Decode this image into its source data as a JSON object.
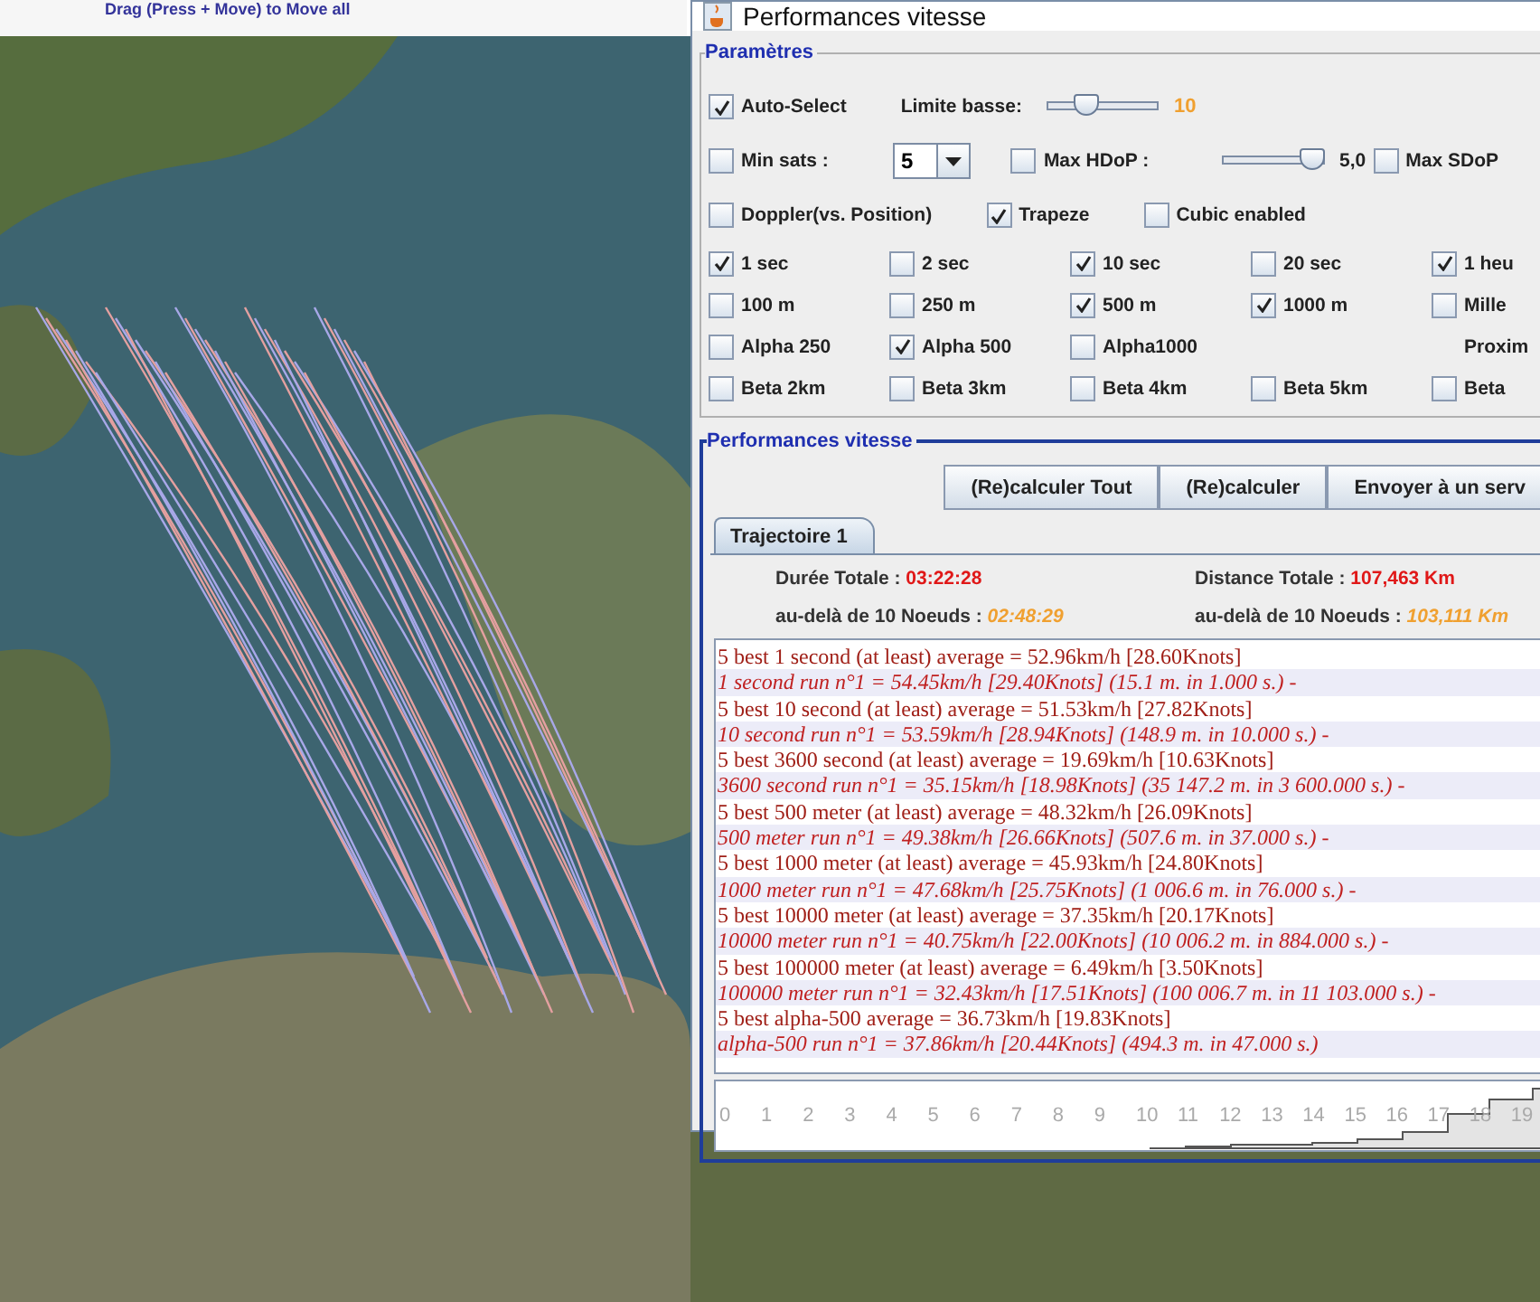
{
  "hint": "Drag (Press + Move) to Move all",
  "window": {
    "title": "Performances vitesse"
  },
  "parameters": {
    "title": "Paramètres",
    "rows": [
      {
        "kind": "controls",
        "items": [
          {
            "kind": "checkbox",
            "label": "Auto-Select",
            "checked": true
          },
          {
            "kind": "label",
            "text": "Limite basse:"
          },
          {
            "kind": "slider",
            "level": 0.3
          },
          {
            "kind": "value",
            "text": "10"
          }
        ]
      },
      {
        "kind": "controls",
        "items": [
          {
            "kind": "checkbox",
            "label": "Min sats :",
            "checked": false
          },
          {
            "kind": "combo",
            "value": "5"
          },
          {
            "kind": "checkbox",
            "label": "Max HDoP :",
            "checked": false
          },
          {
            "kind": "slider",
            "level": 1
          },
          {
            "kind": "label",
            "text": "5,0"
          },
          {
            "kind": "checkbox",
            "label": "Max SDoP",
            "checked": false
          }
        ]
      },
      {
        "kind": "controls",
        "items": [
          {
            "kind": "checkbox",
            "label": "Doppler(vs. Position)",
            "checked": false
          },
          {
            "kind": "checkbox",
            "label": "Trapeze",
            "checked": true
          },
          {
            "kind": "checkbox",
            "label": "Cubic enabled",
            "checked": false
          }
        ]
      },
      {
        "kind": "options",
        "items": [
          {
            "kind": "checkbox",
            "label": "1 sec",
            "checked": true
          },
          {
            "kind": "checkbox",
            "label": "2 sec",
            "checked": false
          },
          {
            "kind": "checkbox",
            "label": "10 sec",
            "checked": true
          },
          {
            "kind": "checkbox",
            "label": "20 sec",
            "checked": false
          },
          {
            "kind": "checkbox",
            "label": "1 heu",
            "checked": true
          }
        ]
      },
      {
        "kind": "options",
        "items": [
          {
            "kind": "checkbox",
            "label": "100 m",
            "checked": false
          },
          {
            "kind": "checkbox",
            "label": "250 m",
            "checked": false
          },
          {
            "kind": "checkbox",
            "label": "500 m",
            "checked": true
          },
          {
            "kind": "checkbox",
            "label": "1000 m",
            "checked": true
          },
          {
            "kind": "checkbox",
            "label": "Mille",
            "checked": false
          }
        ]
      },
      {
        "kind": "options",
        "items": [
          {
            "kind": "checkbox",
            "label": "Alpha 250",
            "checked": false
          },
          {
            "kind": "checkbox",
            "label": "Alpha 500",
            "checked": true
          },
          {
            "kind": "checkbox",
            "label": "Alpha1000",
            "checked": false
          },
          {
            "kind": "label",
            "text": "Proxim"
          }
        ]
      },
      {
        "kind": "options",
        "items": [
          {
            "kind": "checkbox",
            "label": "Beta 2km",
            "checked": false
          },
          {
            "kind": "checkbox",
            "label": "Beta 3km",
            "checked": false
          },
          {
            "kind": "checkbox",
            "label": "Beta 4km",
            "checked": false
          },
          {
            "kind": "checkbox",
            "label": "Beta 5km",
            "checked": false
          },
          {
            "kind": "checkbox",
            "label": "Beta",
            "checked": false
          }
        ]
      }
    ]
  },
  "performances": {
    "title": "Performances vitesse",
    "buttons": [
      "(Re)calculer Tout",
      "(Re)calculer",
      "Envoyer à un serv"
    ],
    "tabs": [
      {
        "label": "Trajectoire 1",
        "selected": true
      }
    ],
    "stats": [
      {
        "kind": "total",
        "label": "Durée Totale :",
        "value": "03:22:28"
      },
      {
        "kind": "total",
        "label": "Distance Totale :",
        "value": "107,463 Km"
      },
      {
        "kind": "threshold",
        "label": "au-delà de  10 Noeuds :",
        "value": "02:48:29"
      },
      {
        "kind": "threshold",
        "label": "au-delà de  10 Noeuds :",
        "value": "103,111 Km"
      }
    ],
    "lines": [
      {
        "kind": "summary",
        "text": "5 best 1 second (at least) average = 52.96km/h [28.60Knots]"
      },
      {
        "kind": "run",
        "text": "1 second run n°1 = 54.45km/h [29.40Knots] (15.1 m. in 1.000 s.) -"
      },
      {
        "kind": "summary",
        "text": "5 best 10 second (at least) average = 51.53km/h [27.82Knots]"
      },
      {
        "kind": "run",
        "text": "10 second run n°1 = 53.59km/h [28.94Knots] (148.9 m. in 10.000 s.) -"
      },
      {
        "kind": "summary",
        "text": "5 best 3600 second (at least) average = 19.69km/h [10.63Knots]"
      },
      {
        "kind": "run",
        "text": "3600 second run n°1 = 35.15km/h [18.98Knots] (35 147.2 m. in 3 600.000 s.) -"
      },
      {
        "kind": "summary",
        "text": "5 best 500 meter (at least) average = 48.32km/h [26.09Knots]"
      },
      {
        "kind": "run",
        "text": "500 meter run n°1 = 49.38km/h [26.66Knots] (507.6 m. in 37.000 s.) -"
      },
      {
        "kind": "summary",
        "text": "5 best 1000 meter (at least) average = 45.93km/h [24.80Knots]"
      },
      {
        "kind": "run",
        "text": "1000 meter run n°1 = 47.68km/h [25.75Knots] (1 006.6 m. in 76.000 s.) -"
      },
      {
        "kind": "summary",
        "text": "5 best 10000 meter (at least) average = 37.35km/h [20.17Knots]"
      },
      {
        "kind": "run",
        "text": "10000 meter run n°1 = 40.75km/h [22.00Knots] (10 006.2 m. in 884.000 s.) -"
      },
      {
        "kind": "summary",
        "text": "5 best 100000 meter (at least) average = 6.49km/h [3.50Knots]"
      },
      {
        "kind": "run",
        "text": "100000 meter run n°1 = 32.43km/h [17.51Knots] (100 006.7 m. in 11 103.000 s.) -"
      },
      {
        "kind": "summary",
        "text": "5 best alpha-500 average = 36.73km/h [19.83Knots]"
      },
      {
        "kind": "run",
        "text": "alpha-500 run n°1 = 37.86km/h [20.44Knots] (494.3 m. in 47.000 s.)"
      }
    ],
    "histogram": {
      "labels": [
        "0",
        "1",
        "2",
        "3",
        "4",
        "5",
        "6",
        "7",
        "8",
        "9",
        "10",
        "11",
        "12",
        "13",
        "14",
        "15",
        "16",
        "17",
        "18",
        "19"
      ]
    }
  }
}
